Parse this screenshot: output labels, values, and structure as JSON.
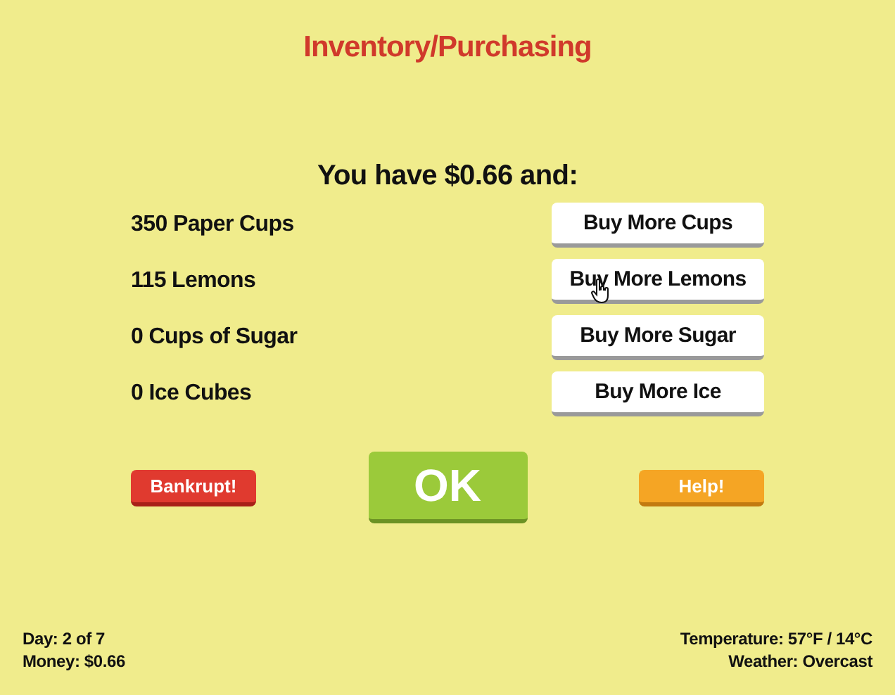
{
  "title": "Inventory/Purchasing",
  "heading": "You have $0.66 and:",
  "items": [
    {
      "label": "350 Paper Cups",
      "button": "Buy More Cups",
      "hovered": false
    },
    {
      "label": "115 Lemons",
      "button": "Buy More Lemons",
      "hovered": true
    },
    {
      "label": "0 Cups of Sugar",
      "button": "Buy More Sugar",
      "hovered": false
    },
    {
      "label": "0 Ice Cubes",
      "button": "Buy More Ice",
      "hovered": false
    }
  ],
  "actions": [
    {
      "label": "Bankrupt!",
      "kind": "danger"
    },
    {
      "label": "OK",
      "kind": "primary"
    },
    {
      "label": "Help!",
      "kind": "warning"
    }
  ],
  "status_left": [
    "Day: 2 of 7",
    "Money: $0.66"
  ],
  "status_right": [
    "Temperature: 57°F / 14°C",
    "Weather: Overcast"
  ]
}
